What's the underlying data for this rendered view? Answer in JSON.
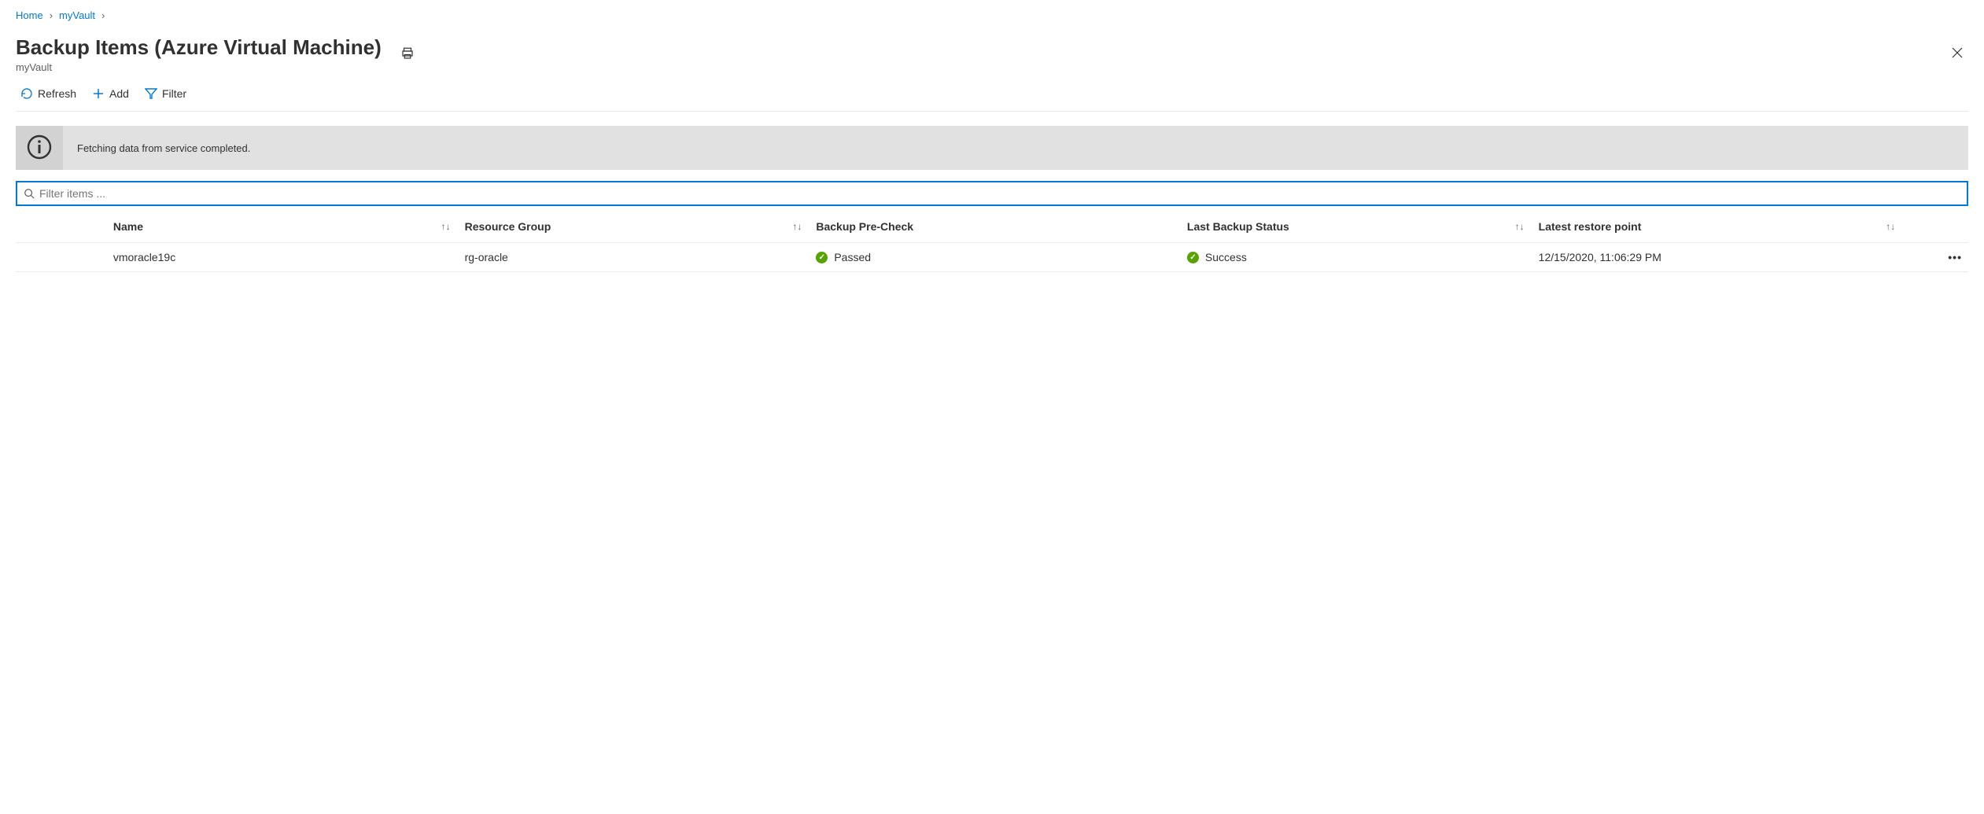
{
  "breadcrumb": {
    "home": "Home",
    "vault": "myVault"
  },
  "header": {
    "title": "Backup Items (Azure Virtual Machine)",
    "subtitle": "myVault"
  },
  "toolbar": {
    "refresh": "Refresh",
    "add": "Add",
    "filter": "Filter"
  },
  "notification": {
    "text": "Fetching data from service completed."
  },
  "filter": {
    "placeholder": "Filter items ..."
  },
  "columns": {
    "name": "Name",
    "resourceGroup": "Resource Group",
    "preCheck": "Backup Pre-Check",
    "lastStatus": "Last Backup Status",
    "restorePoint": "Latest restore point"
  },
  "rows": [
    {
      "name": "vmoracle19c",
      "resourceGroup": "rg-oracle",
      "preCheck": "Passed",
      "lastStatus": "Success",
      "restorePoint": "12/15/2020, 11:06:29 PM"
    }
  ],
  "colors": {
    "accent": "#0078d4",
    "success": "#57a300"
  }
}
